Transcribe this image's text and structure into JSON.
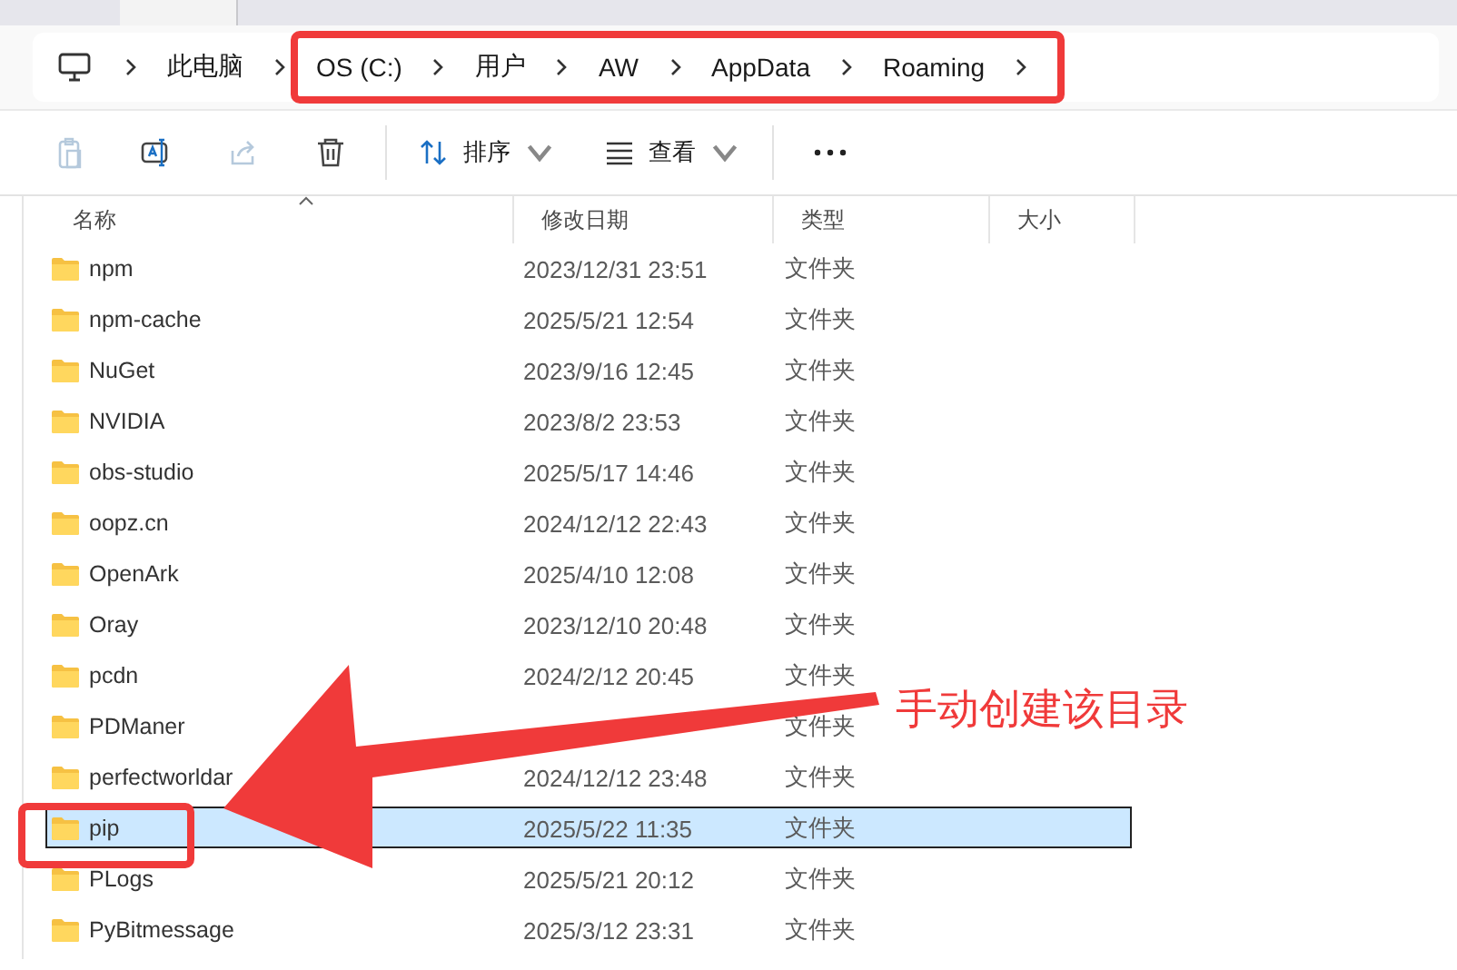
{
  "breadcrumb": {
    "items": [
      "此电脑"
    ],
    "highlighted_items": [
      "OS (C:)",
      "用户",
      "AW",
      "AppData",
      "Roaming"
    ]
  },
  "toolbar": [
    {
      "kind": "paste",
      "disabled": true
    },
    {
      "kind": "rename",
      "disabled": false
    },
    {
      "kind": "share",
      "disabled": true
    },
    {
      "kind": "delete",
      "disabled": false
    },
    {
      "kind": "separator"
    },
    {
      "kind": "sort",
      "label": "排序"
    },
    {
      "kind": "view",
      "label": "查看"
    },
    {
      "kind": "separator"
    },
    {
      "kind": "more"
    }
  ],
  "table": {
    "columns": [
      "名称",
      "修改日期",
      "类型",
      "大小"
    ],
    "rows": [
      {
        "name": "npm",
        "modified": "2023/12/31 23:51",
        "type": "文件夹",
        "selected": false
      },
      {
        "name": "npm-cache",
        "modified": "2025/5/21 12:54",
        "type": "文件夹",
        "selected": false
      },
      {
        "name": "NuGet",
        "modified": "2023/9/16 12:45",
        "type": "文件夹",
        "selected": false
      },
      {
        "name": "NVIDIA",
        "modified": "2023/8/2 23:53",
        "type": "文件夹",
        "selected": false
      },
      {
        "name": "obs-studio",
        "modified": "2025/5/17 14:46",
        "type": "文件夹",
        "selected": false
      },
      {
        "name": "oopz.cn",
        "modified": "2024/12/12 22:43",
        "type": "文件夹",
        "selected": false
      },
      {
        "name": "OpenArk",
        "modified": "2025/4/10 12:08",
        "type": "文件夹",
        "selected": false
      },
      {
        "name": "Oray",
        "modified": "2023/12/10 20:48",
        "type": "文件夹",
        "selected": false
      },
      {
        "name": "pcdn",
        "modified": "2024/2/12 20:45",
        "type": "文件夹",
        "selected": false
      },
      {
        "name": "PDManer",
        "type": "文件夹",
        "selected": false
      },
      {
        "name": "perfectworldar",
        "modified": "2024/12/12 23:48",
        "type": "文件夹",
        "selected": false
      },
      {
        "name": "pip",
        "modified": "2025/5/22 11:35",
        "type": "文件夹",
        "selected": true,
        "boxed": true
      },
      {
        "name": "PLogs",
        "modified": "2025/5/21 20:12",
        "type": "文件夹",
        "selected": false
      },
      {
        "name": "PyBitmessage",
        "modified": "2025/3/12 23:31",
        "type": "文件夹",
        "selected": false
      }
    ]
  },
  "annotation": {
    "text": "手动创建该目录"
  }
}
